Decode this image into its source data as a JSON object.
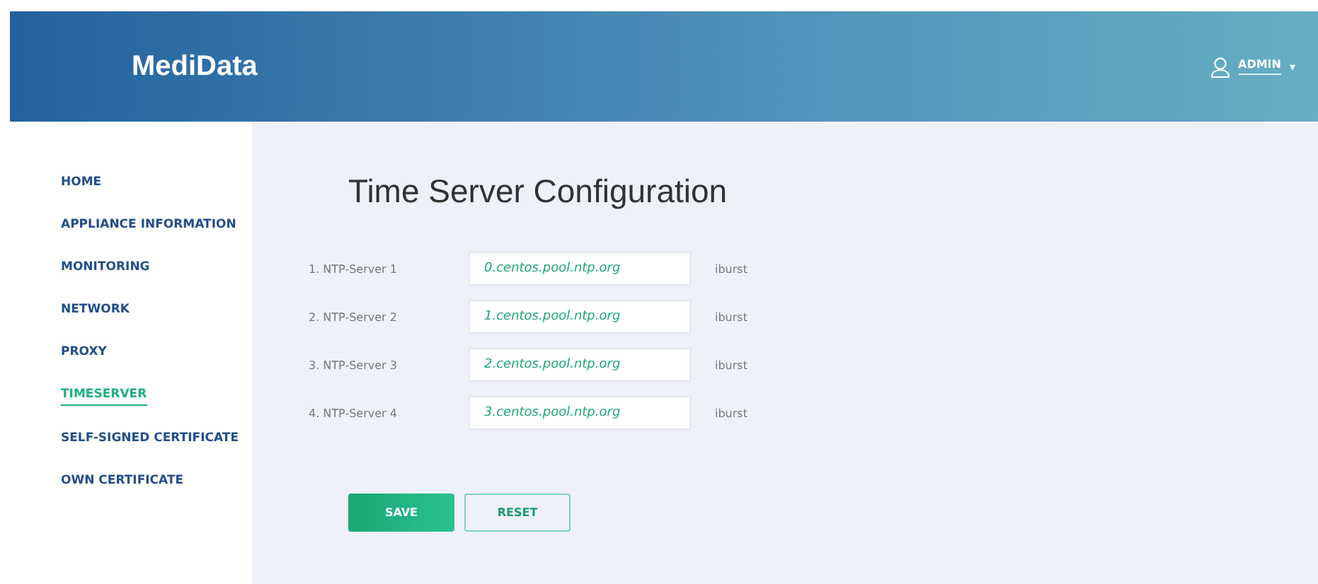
{
  "header": {
    "logo": "MediData",
    "user": "ADMIN",
    "caret": "▾"
  },
  "sidebar": {
    "items": [
      {
        "label": "HOME",
        "selected": false
      },
      {
        "label": "APPLIANCE INFORMATION",
        "selected": false
      },
      {
        "label": "MONITORING",
        "selected": false
      },
      {
        "label": "NETWORK",
        "selected": false
      },
      {
        "label": "PROXY",
        "selected": false
      },
      {
        "label": "TIMESERVER",
        "selected": true
      },
      {
        "label": "SELF-SIGNED CERTIFICATE",
        "selected": false
      },
      {
        "label": "OWN CERTIFICATE",
        "selected": false
      }
    ]
  },
  "main": {
    "title": "Time Server Configuration",
    "servers": [
      {
        "label": "1. NTP-Server 1",
        "value": "0.centos.pool.ntp.org",
        "option": "iburst"
      },
      {
        "label": "2. NTP-Server 2",
        "value": "1.centos.pool.ntp.org",
        "option": "iburst"
      },
      {
        "label": "3. NTP-Server 3",
        "value": "2.centos.pool.ntp.org",
        "option": "iburst"
      },
      {
        "label": "4. NTP-Server 4",
        "value": "3.centos.pool.ntp.org",
        "option": "iburst"
      }
    ],
    "buttons": [
      {
        "label": "SAVE",
        "kind": "primary"
      },
      {
        "label": "RESET",
        "kind": "secondary"
      }
    ]
  }
}
